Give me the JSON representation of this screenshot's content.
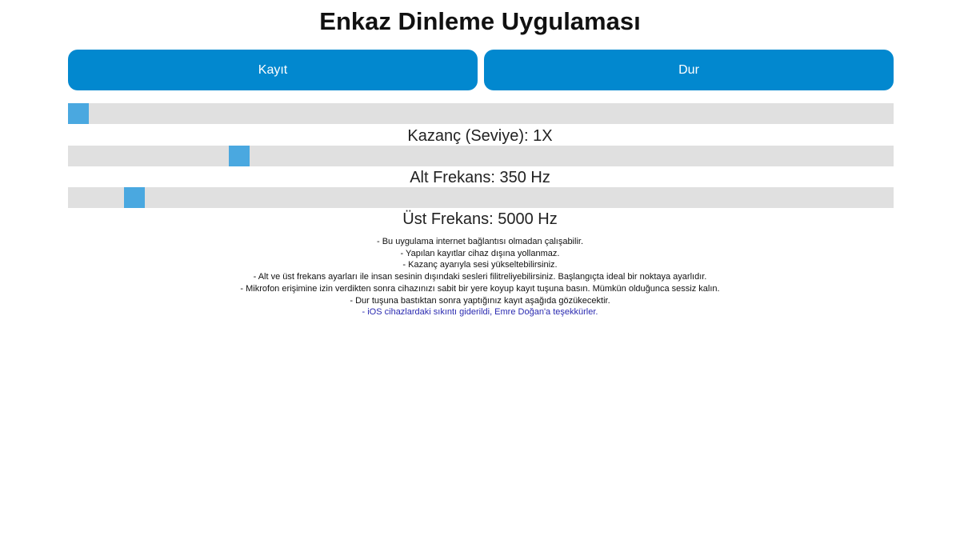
{
  "title": "Enkaz Dinleme Uygulaması",
  "buttons": {
    "record_label": "Kayıt",
    "stop_label": "Dur"
  },
  "colors": {
    "button": "#0288cf",
    "slider_track": "#e0e0e0",
    "slider_thumb": "#4aa8e0",
    "link": "#2a2ab0"
  },
  "sliders": [
    {
      "label": "Kazanç (Seviye): 1X",
      "level_fraction": 0.0
    },
    {
      "label": "Alt Frekans: 350 Hz",
      "level_fraction": 0.2
    },
    {
      "label": "Üst Frekans: 5000 Hz",
      "level_fraction": 0.07
    }
  ],
  "notes": [
    "- Bu uygulama internet bağlantısı olmadan çalışabilir.",
    "- Yapılan kayıtlar cihaz dışına yollanmaz.",
    "- Kazanç ayarıyla sesi yükseltebilirsiniz.",
    "- Alt ve üst frekans ayarları ile insan sesinin dışındaki sesleri filitreliyebilirsiniz. Başlangıçta ideal bir noktaya ayarlıdır.",
    "- Mikrofon erişimine izin verdikten sonra cihazınızı sabit bir yere koyup kayıt tuşuna basın. Mümkün olduğunca sessiz kalın.",
    "- Dur tuşuna bastıktan sonra yaptığınız kayıt aşağıda gözükecektir."
  ],
  "notes_link": "- iOS cihazlardaki sıkıntı giderildi, Emre Doğan'a teşekkürler."
}
